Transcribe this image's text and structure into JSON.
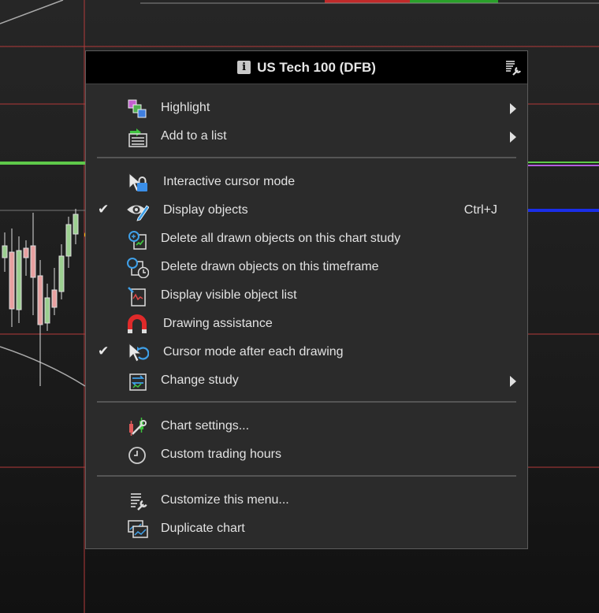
{
  "menu": {
    "title": "US Tech 100 (DFB)",
    "info_icon_glyph": "i",
    "sections": [
      {
        "items": [
          {
            "label": "Highlight",
            "icon": "highlight-icon",
            "submenu": true,
            "checked": false
          },
          {
            "label": "Add to a list",
            "icon": "add-to-list-icon",
            "submenu": true,
            "checked": false
          }
        ]
      },
      {
        "items": [
          {
            "label": "Interactive cursor mode",
            "icon": "cursor-lock-icon",
            "checked": false
          },
          {
            "label": "Display objects",
            "icon": "eye-pencil-icon",
            "checked": true,
            "shortcut": "Ctrl+J"
          },
          {
            "label": "Delete all drawn objects on this chart study",
            "icon": "delete-study-objects-icon",
            "checked": false
          },
          {
            "label": "Delete drawn objects on this timeframe",
            "icon": "delete-timeframe-objects-icon",
            "checked": false
          },
          {
            "label": "Display visible object list",
            "icon": "object-list-icon",
            "checked": false
          },
          {
            "label": "Drawing assistance",
            "icon": "magnet-icon",
            "checked": false
          },
          {
            "label": "Cursor mode after each drawing",
            "icon": "cursor-return-icon",
            "checked": true
          },
          {
            "label": "Change study",
            "icon": "change-study-icon",
            "submenu": true,
            "checked": false
          }
        ]
      },
      {
        "items": [
          {
            "label": "Chart settings...",
            "icon": "chart-settings-icon",
            "checked": false
          },
          {
            "label": "Custom trading hours",
            "icon": "clock-icon",
            "checked": false
          }
        ]
      },
      {
        "items": [
          {
            "label": "Customize this menu...",
            "icon": "customize-menu-icon",
            "checked": false
          },
          {
            "label": "Duplicate chart",
            "icon": "duplicate-chart-icon",
            "checked": false
          }
        ]
      }
    ],
    "check_glyph": "✔"
  },
  "colors": {
    "menu_bg": "#2b2b2b",
    "header_bg": "#000000",
    "pointer_arrow": "#f5c400",
    "grid_line": "#b33a3a"
  }
}
